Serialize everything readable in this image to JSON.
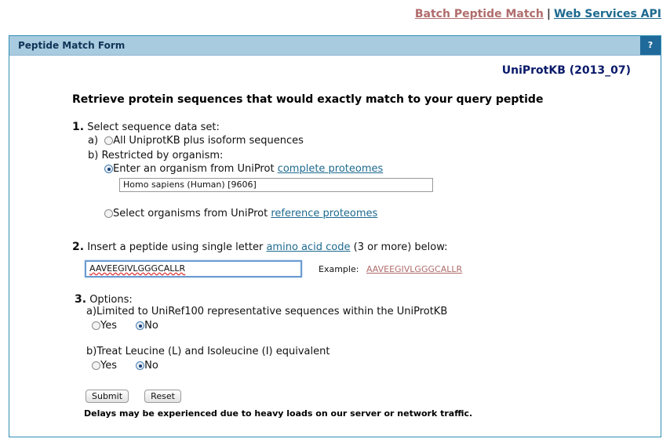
{
  "toplinks": {
    "batch": "Batch Peptide Match",
    "sep": "|",
    "ws": "Web Services API"
  },
  "panel": {
    "title": "Peptide Match Form",
    "help": "?"
  },
  "database": "UniProtKB (2013_07)",
  "heading": "Retrieve protein sequences that would exactly match to your query peptide",
  "step1": {
    "num": "1.",
    "label": "Select sequence data set:",
    "a_prefix": "a)",
    "a_label": "All UniprotKB plus isoform sequences",
    "b_prefix": "b)",
    "b_label": "Restricted by organism:",
    "opt1_text": "Enter an organism from UniProt",
    "opt1_link": "complete proteomes",
    "organism_value": "Homo sapiens (Human) [9606]",
    "opt2_text": "Select organisms from UniProt",
    "opt2_link": "reference proteomes"
  },
  "step2": {
    "num": "2.",
    "text_pre": "Insert a peptide using single letter",
    "link": "amino acid code",
    "text_post": "(3 or more) below:",
    "peptide_value": "AAVEEGIVLGGGCALLR",
    "example_label": "Example:",
    "example_value": "AAVEEGIVLGGGCALLR"
  },
  "step3": {
    "num": "3.",
    "label": "Options:",
    "opt_a": "a)Limited to UniRef100 representative sequences within the UniProtKB",
    "opt_b": "b)Treat Leucine (L) and Isoleucine (I) equivalent",
    "yes": "Yes",
    "no": "No"
  },
  "buttons": {
    "submit": "Submit",
    "reset": "Reset"
  },
  "notice": "Delays may be experienced due to heavy loads on our server or network traffic."
}
